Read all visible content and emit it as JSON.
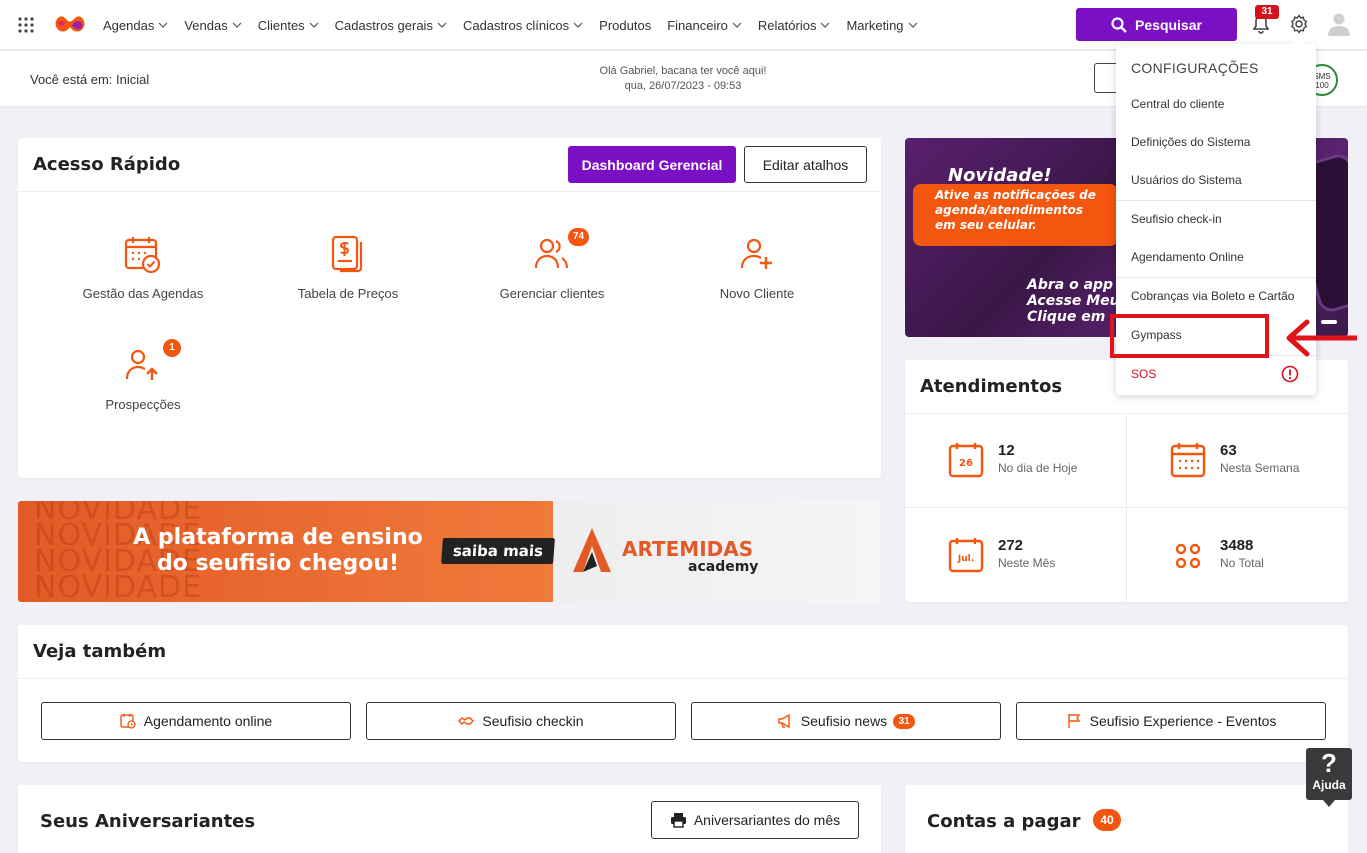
{
  "nav": {
    "items": [
      {
        "label": "Agendas",
        "dropdown": true
      },
      {
        "label": "Vendas",
        "dropdown": true
      },
      {
        "label": "Clientes",
        "dropdown": true
      },
      {
        "label": "Cadastros gerais",
        "dropdown": true
      },
      {
        "label": "Cadastros clínicos",
        "dropdown": true
      },
      {
        "label": "Produtos",
        "dropdown": false
      },
      {
        "label": "Financeiro",
        "dropdown": true
      },
      {
        "label": "Relatórios",
        "dropdown": true
      },
      {
        "label": "Marketing",
        "dropdown": true
      }
    ],
    "search_label": "Pesquisar",
    "notification_count": "31"
  },
  "subheader": {
    "breadcrumb": "Você está em: Inicial",
    "greeting": "Olá Gabriel, bacana ter você aqui!",
    "datetime": "qua, 26/07/2023 - 09:53",
    "sms_badge": "SMS 100"
  },
  "quick_access": {
    "title": "Acesso Rápido",
    "dashboard_label": "Dashboard Gerencial",
    "edit_label": "Editar atalhos",
    "shortcuts": [
      {
        "label": "Gestão das Agendas",
        "icon": "calendar-check-icon",
        "badge": ""
      },
      {
        "label": "Tabela de Preços",
        "icon": "price-table-icon",
        "badge": ""
      },
      {
        "label": "Gerenciar clientes",
        "icon": "users-icon",
        "badge": "74"
      },
      {
        "label": "Novo Cliente",
        "icon": "user-plus-icon",
        "badge": ""
      },
      {
        "label": "Prospecções",
        "icon": "user-up-icon",
        "badge": "1"
      }
    ]
  },
  "promo": {
    "bg_text": "NOVIDADE",
    "headline_line1": "A plataforma de ensino",
    "headline_line2": "do seufisio chegou!",
    "cta": "saiba mais",
    "brand": "ARTEMIDAS",
    "brand_sub": "academy"
  },
  "novidade_banner": {
    "title": "Novidade!",
    "line1": "Ative as notificações de",
    "line2": "agenda/atendimentos",
    "line3": "em seu celular.",
    "bottom1": "Abra o app",
    "bottom2": "Acesse Meu",
    "bottom3": "Clique em"
  },
  "atendimentos": {
    "title": "Atendimentos",
    "stats": [
      {
        "value": "12",
        "label": "No dia de Hoje",
        "icon": "calendar-day-icon",
        "icon_text": "26"
      },
      {
        "value": "63",
        "label": "Nesta Semana",
        "icon": "calendar-week-icon",
        "icon_text": ""
      },
      {
        "value": "272",
        "label": "Neste Mês",
        "icon": "calendar-month-icon",
        "icon_text": "Jul."
      },
      {
        "value": "3488",
        "label": "No Total",
        "icon": "grid-icon",
        "icon_text": ""
      }
    ]
  },
  "veja": {
    "title": "Veja também",
    "buttons": [
      {
        "label": "Agendamento online",
        "icon": "calendar-clock-icon",
        "badge": ""
      },
      {
        "label": "Seufisio checkin",
        "icon": "handshake-icon",
        "badge": ""
      },
      {
        "label": "Seufisio news",
        "icon": "megaphone-icon",
        "badge": "31"
      },
      {
        "label": "Seufisio Experience - Eventos",
        "icon": "flag-icon",
        "badge": ""
      }
    ]
  },
  "aniversariantes": {
    "title": "Seus Aniversariantes",
    "button_label": "Aniversariantes do mês"
  },
  "contas": {
    "title": "Contas a pagar",
    "badge": "40"
  },
  "help": {
    "symbol": "?",
    "label": "Ajuda"
  },
  "config_menu": {
    "title": "CONFIGURAÇÕES",
    "items": [
      "Central do cliente",
      "Definições do Sistema",
      "Usuários do Sistema",
      "Seufisio check-in",
      "Agendamento Online",
      "Cobranças via Boleto e Cartão",
      "Gympass",
      "SOS"
    ]
  },
  "colors": {
    "primary": "#7b0fc4",
    "accent": "#f3560f",
    "alert": "#d5111e"
  }
}
